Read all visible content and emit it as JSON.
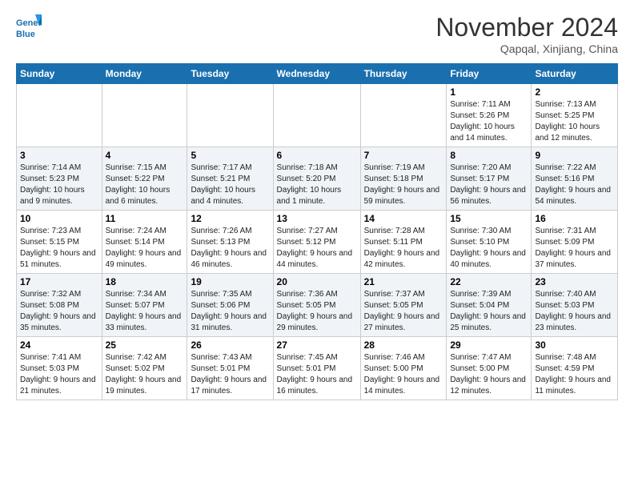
{
  "header": {
    "logo_line1": "General",
    "logo_line2": "Blue",
    "month_title": "November 2024",
    "location": "Qapqal, Xinjiang, China"
  },
  "weekdays": [
    "Sunday",
    "Monday",
    "Tuesday",
    "Wednesday",
    "Thursday",
    "Friday",
    "Saturday"
  ],
  "weeks": [
    [
      {
        "day": "",
        "info": ""
      },
      {
        "day": "",
        "info": ""
      },
      {
        "day": "",
        "info": ""
      },
      {
        "day": "",
        "info": ""
      },
      {
        "day": "",
        "info": ""
      },
      {
        "day": "1",
        "info": "Sunrise: 7:11 AM\nSunset: 5:26 PM\nDaylight: 10 hours and 14 minutes."
      },
      {
        "day": "2",
        "info": "Sunrise: 7:13 AM\nSunset: 5:25 PM\nDaylight: 10 hours and 12 minutes."
      }
    ],
    [
      {
        "day": "3",
        "info": "Sunrise: 7:14 AM\nSunset: 5:23 PM\nDaylight: 10 hours and 9 minutes."
      },
      {
        "day": "4",
        "info": "Sunrise: 7:15 AM\nSunset: 5:22 PM\nDaylight: 10 hours and 6 minutes."
      },
      {
        "day": "5",
        "info": "Sunrise: 7:17 AM\nSunset: 5:21 PM\nDaylight: 10 hours and 4 minutes."
      },
      {
        "day": "6",
        "info": "Sunrise: 7:18 AM\nSunset: 5:20 PM\nDaylight: 10 hours and 1 minute."
      },
      {
        "day": "7",
        "info": "Sunrise: 7:19 AM\nSunset: 5:18 PM\nDaylight: 9 hours and 59 minutes."
      },
      {
        "day": "8",
        "info": "Sunrise: 7:20 AM\nSunset: 5:17 PM\nDaylight: 9 hours and 56 minutes."
      },
      {
        "day": "9",
        "info": "Sunrise: 7:22 AM\nSunset: 5:16 PM\nDaylight: 9 hours and 54 minutes."
      }
    ],
    [
      {
        "day": "10",
        "info": "Sunrise: 7:23 AM\nSunset: 5:15 PM\nDaylight: 9 hours and 51 minutes."
      },
      {
        "day": "11",
        "info": "Sunrise: 7:24 AM\nSunset: 5:14 PM\nDaylight: 9 hours and 49 minutes."
      },
      {
        "day": "12",
        "info": "Sunrise: 7:26 AM\nSunset: 5:13 PM\nDaylight: 9 hours and 46 minutes."
      },
      {
        "day": "13",
        "info": "Sunrise: 7:27 AM\nSunset: 5:12 PM\nDaylight: 9 hours and 44 minutes."
      },
      {
        "day": "14",
        "info": "Sunrise: 7:28 AM\nSunset: 5:11 PM\nDaylight: 9 hours and 42 minutes."
      },
      {
        "day": "15",
        "info": "Sunrise: 7:30 AM\nSunset: 5:10 PM\nDaylight: 9 hours and 40 minutes."
      },
      {
        "day": "16",
        "info": "Sunrise: 7:31 AM\nSunset: 5:09 PM\nDaylight: 9 hours and 37 minutes."
      }
    ],
    [
      {
        "day": "17",
        "info": "Sunrise: 7:32 AM\nSunset: 5:08 PM\nDaylight: 9 hours and 35 minutes."
      },
      {
        "day": "18",
        "info": "Sunrise: 7:34 AM\nSunset: 5:07 PM\nDaylight: 9 hours and 33 minutes."
      },
      {
        "day": "19",
        "info": "Sunrise: 7:35 AM\nSunset: 5:06 PM\nDaylight: 9 hours and 31 minutes."
      },
      {
        "day": "20",
        "info": "Sunrise: 7:36 AM\nSunset: 5:05 PM\nDaylight: 9 hours and 29 minutes."
      },
      {
        "day": "21",
        "info": "Sunrise: 7:37 AM\nSunset: 5:05 PM\nDaylight: 9 hours and 27 minutes."
      },
      {
        "day": "22",
        "info": "Sunrise: 7:39 AM\nSunset: 5:04 PM\nDaylight: 9 hours and 25 minutes."
      },
      {
        "day": "23",
        "info": "Sunrise: 7:40 AM\nSunset: 5:03 PM\nDaylight: 9 hours and 23 minutes."
      }
    ],
    [
      {
        "day": "24",
        "info": "Sunrise: 7:41 AM\nSunset: 5:03 PM\nDaylight: 9 hours and 21 minutes."
      },
      {
        "day": "25",
        "info": "Sunrise: 7:42 AM\nSunset: 5:02 PM\nDaylight: 9 hours and 19 minutes."
      },
      {
        "day": "26",
        "info": "Sunrise: 7:43 AM\nSunset: 5:01 PM\nDaylight: 9 hours and 17 minutes."
      },
      {
        "day": "27",
        "info": "Sunrise: 7:45 AM\nSunset: 5:01 PM\nDaylight: 9 hours and 16 minutes."
      },
      {
        "day": "28",
        "info": "Sunrise: 7:46 AM\nSunset: 5:00 PM\nDaylight: 9 hours and 14 minutes."
      },
      {
        "day": "29",
        "info": "Sunrise: 7:47 AM\nSunset: 5:00 PM\nDaylight: 9 hours and 12 minutes."
      },
      {
        "day": "30",
        "info": "Sunrise: 7:48 AM\nSunset: 4:59 PM\nDaylight: 9 hours and 11 minutes."
      }
    ]
  ]
}
